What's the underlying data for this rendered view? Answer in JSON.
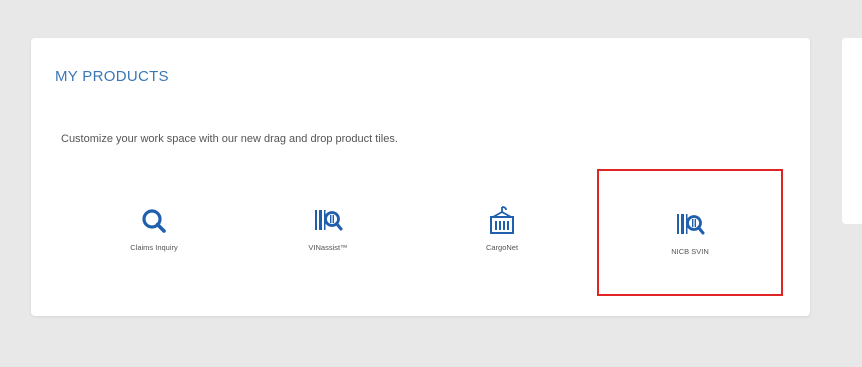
{
  "products": {
    "title": "MY PRODUCTS",
    "subtitle": "Customize your work space with our new drag and drop product tiles.",
    "tiles": [
      {
        "label": "Claims Inquiry",
        "icon": "search-icon"
      },
      {
        "label": "VINassist™",
        "icon": "barcode-search-icon"
      },
      {
        "label": "CargoNet",
        "icon": "cargo-container-icon"
      },
      {
        "label": "NICB SVIN",
        "icon": "barcode-search-icon"
      }
    ]
  },
  "colors": {
    "title": "#3a78b5",
    "icon": "#1f5fae",
    "highlight": "#e02424"
  }
}
